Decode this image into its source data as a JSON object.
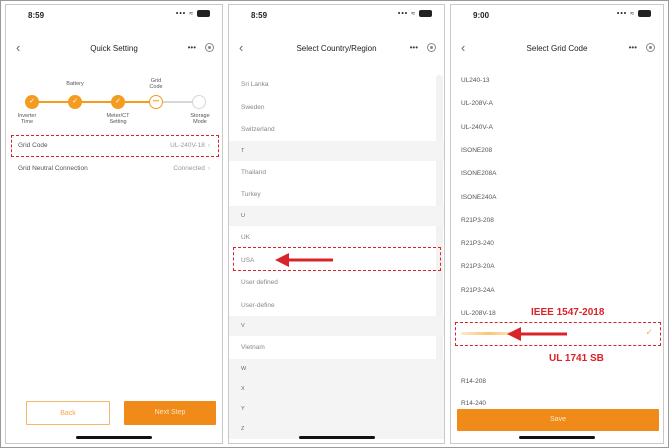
{
  "screen1": {
    "time": "8:59",
    "title": "Quick Setting",
    "more": "•••",
    "steps": [
      {
        "label": "Inverter\nTime",
        "state": "done"
      },
      {
        "label": "Battery",
        "state": "done"
      },
      {
        "label": "Meter/CT\nSetting",
        "state": "done"
      },
      {
        "label": "Grid\nCode",
        "state": "current"
      },
      {
        "label": "Storage\nMode",
        "state": "todo"
      }
    ],
    "rows": [
      {
        "label": "Grid Code",
        "value": "UL-240V-18"
      },
      {
        "label": "Grid Neutral Connection",
        "value": "Connected"
      }
    ],
    "back_button": "Back",
    "next_button": "Next Step"
  },
  "screen2": {
    "time": "8:59",
    "title": "Select Country/Region",
    "more": "•••",
    "items": [
      {
        "text": "Sri Lanka",
        "type": "item"
      },
      {
        "text": "Sweden",
        "type": "item"
      },
      {
        "text": "Switzerland",
        "type": "item"
      },
      {
        "text": "T",
        "type": "letter"
      },
      {
        "text": "Thailand",
        "type": "item"
      },
      {
        "text": "Turkey",
        "type": "item"
      },
      {
        "text": "U",
        "type": "letter"
      },
      {
        "text": "UK",
        "type": "item"
      },
      {
        "text": "USA",
        "type": "item"
      },
      {
        "text": "User defined",
        "type": "item"
      },
      {
        "text": "User-define",
        "type": "item"
      },
      {
        "text": "V",
        "type": "letter"
      },
      {
        "text": "Vietnam",
        "type": "item"
      },
      {
        "text": "W",
        "type": "letter"
      },
      {
        "text": "X",
        "type": "letter"
      },
      {
        "text": "Y",
        "type": "letter"
      },
      {
        "text": "Z",
        "type": "letter"
      }
    ]
  },
  "screen3": {
    "time": "9:00",
    "title": "Select Grid Code",
    "more": "•••",
    "items_top": [
      "UL240-13",
      "UL-208V-A",
      "UL-240V-A",
      "ISONE208",
      "ISONE208A",
      "ISONE240A",
      "R21P3-208",
      "R21P3-240",
      "R21P3-20A",
      "R21P3-24A",
      "UL-208V-18"
    ],
    "items_bottom": [
      "R14-208",
      "R14-240"
    ],
    "save_button": "Save"
  },
  "annotations": {
    "ieee": "IEEE 1547-2018",
    "ul": "UL 1741 SB"
  },
  "colors": {
    "accent": "#f08a18",
    "highlight": "#d9232a"
  },
  "icons": {
    "back": "‹",
    "check": "✓"
  }
}
